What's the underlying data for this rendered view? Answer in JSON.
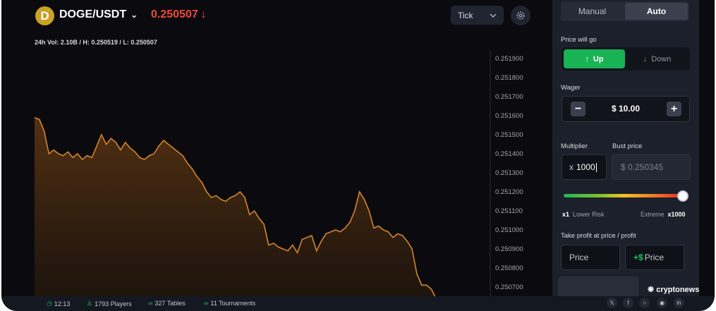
{
  "header": {
    "coin_letter": "D",
    "pair": "DOGE/USDT",
    "price": "0.250507",
    "stats": "24h Vol: 2.10B / H: 0.250519 / L: 0.250507",
    "tick_select": "Tick"
  },
  "chart_data": {
    "type": "area",
    "y_ticks": [
      "0.251900",
      "0.251800",
      "0.251700",
      "0.251600",
      "0.251500",
      "0.251400",
      "0.251300",
      "0.251200",
      "0.251100",
      "0.251000",
      "0.250900",
      "0.250800",
      "0.250700"
    ],
    "ylim": [
      0.25067,
      0.25193
    ],
    "series": [
      {
        "values": [
          0.25159,
          0.25158,
          0.25152,
          0.2514,
          0.25142,
          0.2514,
          0.25139,
          0.25141,
          0.25138,
          0.2514,
          0.25137,
          0.25139,
          0.25138,
          0.25144,
          0.2515,
          0.25145,
          0.25148,
          0.25146,
          0.25142,
          0.25146,
          0.25143,
          0.25141,
          0.25138,
          0.25137,
          0.25139,
          0.2514,
          0.25144,
          0.25147,
          0.25145,
          0.25143,
          0.25141,
          0.25139,
          0.25135,
          0.25132,
          0.25128,
          0.25125,
          0.2512,
          0.25117,
          0.25118,
          0.25116,
          0.25115,
          0.25117,
          0.25118,
          0.2512,
          0.25117,
          0.25108,
          0.2511,
          0.25106,
          0.25103,
          0.25092,
          0.25093,
          0.25091,
          0.2509,
          0.25089,
          0.25092,
          0.25088,
          0.25095,
          0.25096,
          0.25097,
          0.25089,
          0.25094,
          0.25098,
          0.25099,
          0.251,
          0.25099,
          0.25101,
          0.25104,
          0.2511,
          0.2512,
          0.25116,
          0.2511,
          0.25101,
          0.25102,
          0.251,
          0.25099,
          0.25096,
          0.25098,
          0.25097,
          0.25094,
          0.2509,
          0.25077,
          0.25071,
          0.25071,
          0.25069,
          0.25064
        ]
      }
    ]
  },
  "panel": {
    "mode_tabs": [
      "Manual",
      "Auto"
    ],
    "price_will_go": "Price will go",
    "up": "Up",
    "down": "Down",
    "wager_label": "Wager",
    "wager_value": "$ 10.00",
    "multiplier_label": "Multiplier",
    "multiplier_prefix": "x",
    "multiplier_value": "1000",
    "bust_label": "Bust price",
    "bust_value": "$ 0.250345",
    "risk_min_value": "x1",
    "risk_min_label": "Lower Risk",
    "risk_max_label": "Extreme",
    "risk_max_value": "x1000",
    "take_profit_label": "Take profit at price / profit",
    "tp_price": "Price",
    "tp_profit_prefix": "+$",
    "tp_profit": "Price"
  },
  "brand": "cryptonews",
  "footer": {
    "time": "12:13",
    "players": "1793 Players",
    "tables": "327 Tables",
    "tournaments": "11 Tournaments",
    "socials": [
      "x-icon",
      "facebook-icon",
      "instagram-icon",
      "discord-icon",
      "linkedin-icon"
    ]
  },
  "colors": {
    "line": "#d4852c",
    "price_down": "#f0473a",
    "up_button": "#19b254"
  }
}
